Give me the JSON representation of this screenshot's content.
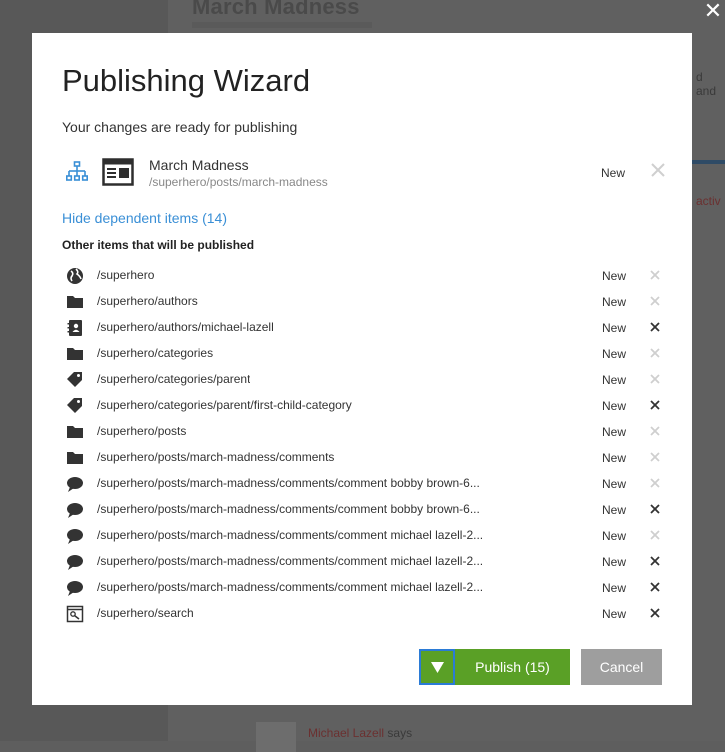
{
  "background": {
    "page_title": "March Madness",
    "side_text_1": "d and",
    "side_text_2": "activ",
    "comment_author": "Michael Lazell",
    "comment_verb": "says"
  },
  "dialog": {
    "title": "Publishing Wizard",
    "subtitle": "Your changes are ready for publishing",
    "main_item": {
      "name": "March Madness",
      "path": "/superhero/posts/march-madness",
      "status": "New",
      "icons": [
        "sitemap-icon",
        "document-icon"
      ]
    },
    "toggle_label": "Hide dependent items (14)",
    "section_heading": "Other items that will be published",
    "dependent_items": [
      {
        "path": "/superhero",
        "status": "New",
        "icon": "globe",
        "remove_active": false
      },
      {
        "path": "/superhero/authors",
        "status": "New",
        "icon": "folder",
        "remove_active": false
      },
      {
        "path": "/superhero/authors/michael-lazell",
        "status": "New",
        "icon": "contact-book",
        "remove_active": true
      },
      {
        "path": "/superhero/categories",
        "status": "New",
        "icon": "folder",
        "remove_active": false
      },
      {
        "path": "/superhero/categories/parent",
        "status": "New",
        "icon": "tag",
        "remove_active": false
      },
      {
        "path": "/superhero/categories/parent/first-child-category",
        "status": "New",
        "icon": "tag",
        "remove_active": true
      },
      {
        "path": "/superhero/posts",
        "status": "New",
        "icon": "folder",
        "remove_active": false
      },
      {
        "path": "/superhero/posts/march-madness/comments",
        "status": "New",
        "icon": "folder",
        "remove_active": false
      },
      {
        "path": "/superhero/posts/march-madness/comments/comment bobby brown-6...",
        "status": "New",
        "icon": "speech-bubble",
        "remove_active": false
      },
      {
        "path": "/superhero/posts/march-madness/comments/comment bobby brown-6...",
        "status": "New",
        "icon": "speech-bubble",
        "remove_active": true
      },
      {
        "path": "/superhero/posts/march-madness/comments/comment michael lazell-2...",
        "status": "New",
        "icon": "speech-bubble",
        "remove_active": false
      },
      {
        "path": "/superhero/posts/march-madness/comments/comment michael lazell-2...",
        "status": "New",
        "icon": "speech-bubble",
        "remove_active": true
      },
      {
        "path": "/superhero/posts/march-madness/comments/comment michael lazell-2...",
        "status": "New",
        "icon": "speech-bubble",
        "remove_active": true
      },
      {
        "path": "/superhero/search",
        "status": "New",
        "icon": "search-page",
        "remove_active": true
      }
    ],
    "buttons": {
      "publish_label": "Publish (15)",
      "cancel_label": "Cancel"
    }
  },
  "colors": {
    "publish_green": "#5aa026",
    "link_blue": "#3a8fd6",
    "cancel_gray": "#9e9e9e",
    "focus_blue": "#2b7bd6"
  }
}
